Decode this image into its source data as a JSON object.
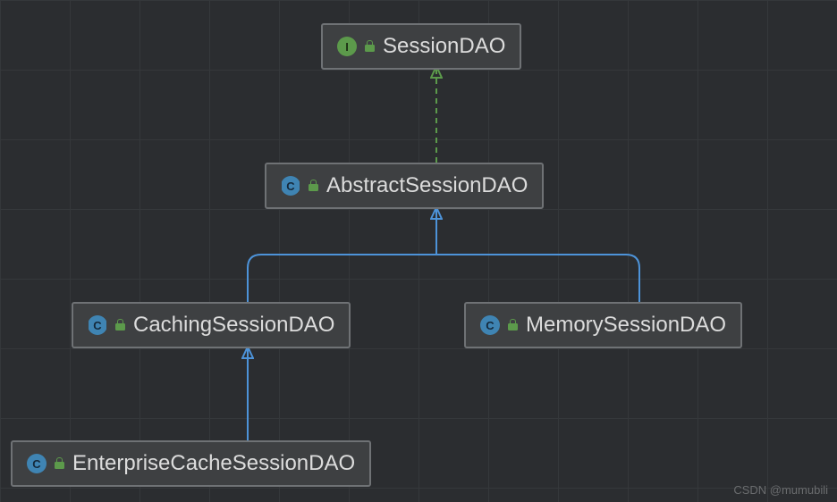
{
  "nodes": {
    "session_dao": {
      "label": "SessionDAO",
      "type": "interface",
      "type_letter": "I"
    },
    "abstract_session_dao": {
      "label": "AbstractSessionDAO",
      "type": "abstract_class",
      "type_letter": "C"
    },
    "caching_session_dao": {
      "label": "CachingSessionDAO",
      "type": "abstract_class",
      "type_letter": "C"
    },
    "memory_session_dao": {
      "label": "MemorySessionDAO",
      "type": "class",
      "type_letter": "C"
    },
    "enterprise_cache_session_dao": {
      "label": "EnterpriseCacheSessionDAO",
      "type": "class",
      "type_letter": "C"
    }
  },
  "connectors": [
    {
      "from": "abstract_session_dao",
      "to": "session_dao",
      "style": "implements"
    },
    {
      "from": "caching_session_dao",
      "to": "abstract_session_dao",
      "style": "extends"
    },
    {
      "from": "memory_session_dao",
      "to": "abstract_session_dao",
      "style": "extends"
    },
    {
      "from": "enterprise_cache_session_dao",
      "to": "caching_session_dao",
      "style": "extends"
    }
  ],
  "colors": {
    "implements_line": "#5c9a4b",
    "extends_line": "#4d93d9",
    "node_bg": "#3e4042",
    "node_border": "#6f7275",
    "canvas_bg": "#2b2d30"
  },
  "watermark": "CSDN @mumubili"
}
